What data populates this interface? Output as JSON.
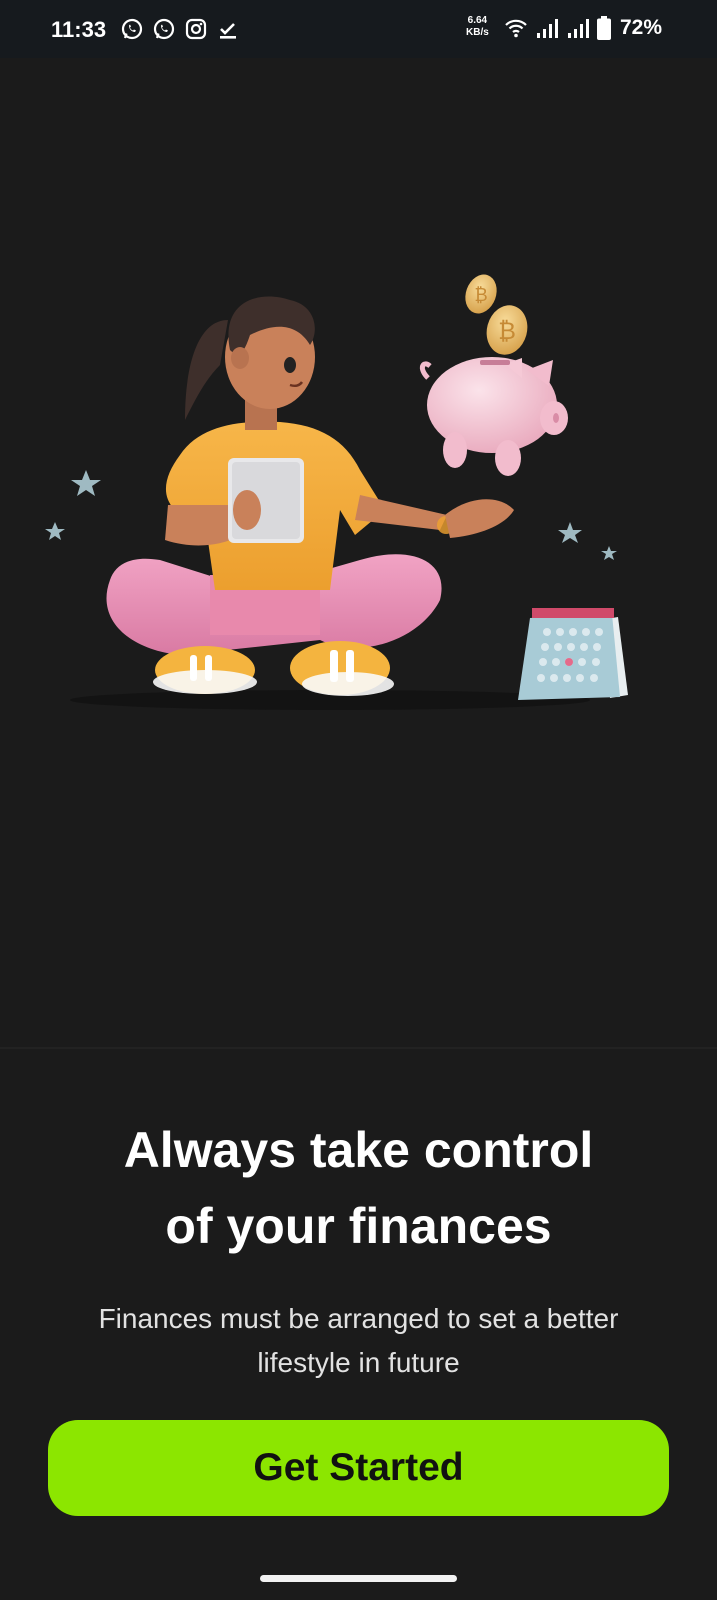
{
  "status_bar": {
    "time": "11:33",
    "network_speed_value": "6.64",
    "network_speed_unit": "KB/s",
    "battery": "72%",
    "notification_icons": [
      "whatsapp-icon",
      "whatsapp-icon",
      "instagram-icon",
      "download-done-icon"
    ],
    "system_icons": [
      "wifi-icon",
      "signal-icon",
      "signal-icon",
      "battery-icon"
    ]
  },
  "onboarding": {
    "headline_line1": "Always take control",
    "headline_line2": "of your finances",
    "subtitle_line1": "Finances must be arranged to set a better",
    "subtitle_line2": "lifestyle in future",
    "cta_label": "Get Started",
    "illustration": "woman-with-tablet-piggy-bank-coins-calendar"
  },
  "colors": {
    "background": "#1b1b1b",
    "status_bar": "#161a1e",
    "accent": "#8ce600",
    "text_primary": "#ffffff",
    "text_secondary": "#e2e2e2"
  }
}
